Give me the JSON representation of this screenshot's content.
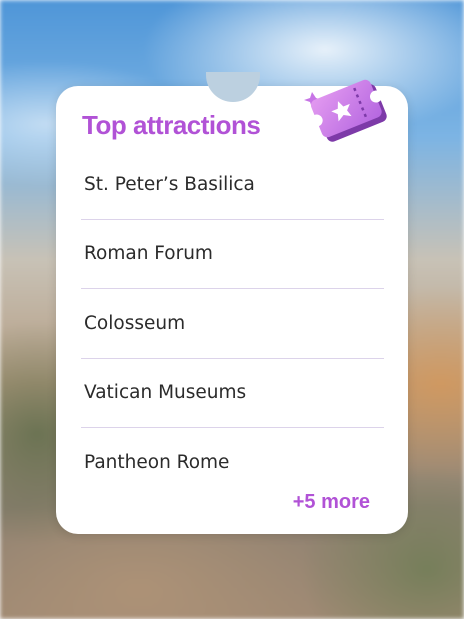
{
  "card": {
    "title": "Top attractions",
    "items": [
      {
        "label": "St. Peter’s Basilica"
      },
      {
        "label": "Roman Forum"
      },
      {
        "label": "Colosseum"
      },
      {
        "label": "Vatican Museums"
      },
      {
        "label": "Pantheon Rome"
      }
    ],
    "more_label": "+5 more",
    "icon": "ticket-icon"
  },
  "colors": {
    "accent": "#b152d6",
    "divider": "#dcd3ea",
    "text": "#2b2b2b"
  }
}
